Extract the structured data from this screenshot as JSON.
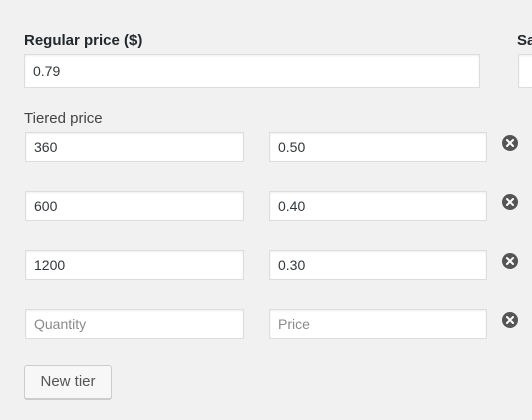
{
  "regular_price": {
    "label": "Regular price ($)",
    "value": "0.79"
  },
  "sale_price": {
    "label_partial": "Sa"
  },
  "tiers": {
    "label": "Tiered price",
    "rows": [
      {
        "quantity": "360",
        "price": "0.50"
      },
      {
        "quantity": "600",
        "price": "0.40"
      },
      {
        "quantity": "1200",
        "price": "0.30"
      },
      {
        "quantity": "",
        "price": ""
      }
    ],
    "quantity_placeholder": "Quantity",
    "price_placeholder": "Price",
    "remove_icon": "remove-circle-icon"
  },
  "new_tier_label": "New tier"
}
